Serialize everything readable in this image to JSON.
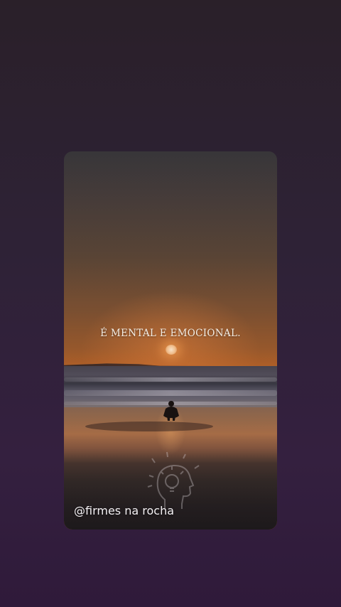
{
  "story": {
    "quote_text": "É MENTAL E EMOCIONAL.",
    "username": "@firmes na rocha",
    "watermark_icon": "head-lightbulb-icon"
  },
  "colors": {
    "background_top": "#2a2029",
    "background_bottom": "#2f1a3a",
    "sunset_orange": "#c56a2a",
    "text_light": "#f5efe6"
  }
}
